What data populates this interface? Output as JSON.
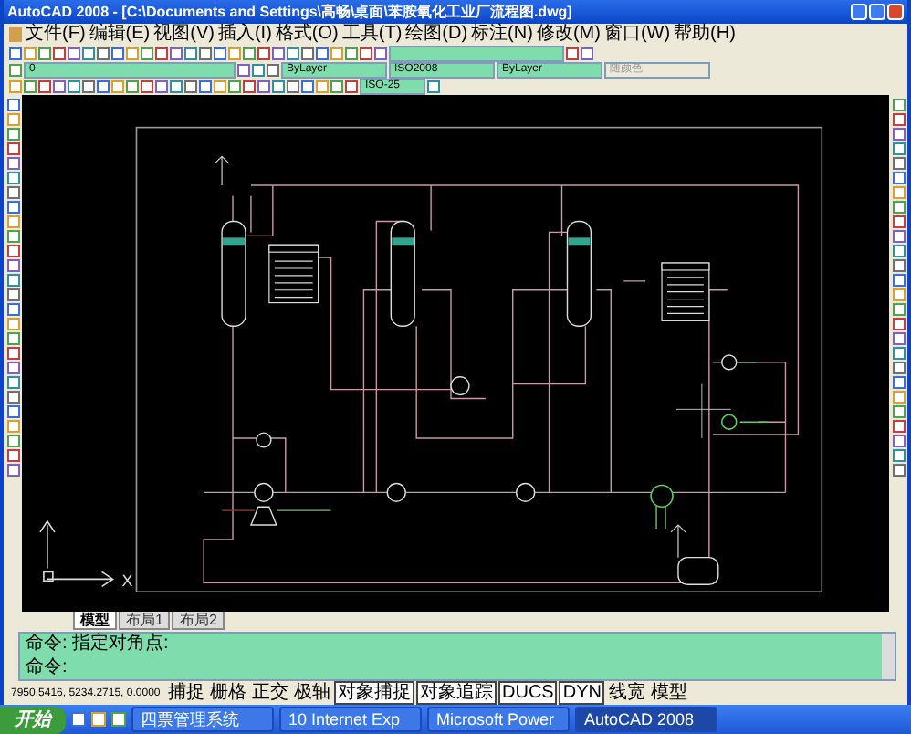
{
  "window": {
    "title": "AutoCAD 2008 - [C:\\Documents and Settings\\高畅\\桌面\\苯胺氧化工业厂流程图.dwg]"
  },
  "menu": [
    "文件(F)",
    "编辑(E)",
    "视图(V)",
    "插入(I)",
    "格式(O)",
    "工具(T)",
    "绘图(D)",
    "标注(N)",
    "修改(M)",
    "窗口(W)",
    "帮助(H)"
  ],
  "properties": {
    "layer": "0",
    "color_control": "ByLayer",
    "linetype": "ISO2008",
    "lineweight": "ByLayer",
    "plotstyle": "随颜色",
    "dimstyle": "ISO-25"
  },
  "canvas": {
    "ucs_x": "X"
  },
  "layout_tabs": [
    {
      "label": "模型",
      "selected": true
    },
    {
      "label": "布局1",
      "selected": false
    },
    {
      "label": "布局2",
      "selected": false
    }
  ],
  "command_lines": [
    "命令: 指定对角点:",
    "命令:"
  ],
  "status_bar": {
    "coordinates": "7950.5416, 5234.2715, 0.0000",
    "toggles": [
      {
        "label": "捕捉",
        "on": false
      },
      {
        "label": "栅格",
        "on": false
      },
      {
        "label": "正交",
        "on": false
      },
      {
        "label": "极轴",
        "on": false
      },
      {
        "label": "对象捕捉",
        "on": true
      },
      {
        "label": "对象追踪",
        "on": true
      },
      {
        "label": "DUCS",
        "on": true
      },
      {
        "label": "DYN",
        "on": true
      },
      {
        "label": "线宽",
        "on": false
      },
      {
        "label": "模型",
        "on": false
      }
    ]
  },
  "taskbar": {
    "start": "开始",
    "tasks": [
      {
        "label": "四票管理系统",
        "selected": false
      },
      {
        "label": "10 Internet Exp",
        "selected": false
      },
      {
        "label": "Microsoft Power",
        "selected": false
      },
      {
        "label": "AutoCAD 2008",
        "selected": true
      }
    ]
  }
}
